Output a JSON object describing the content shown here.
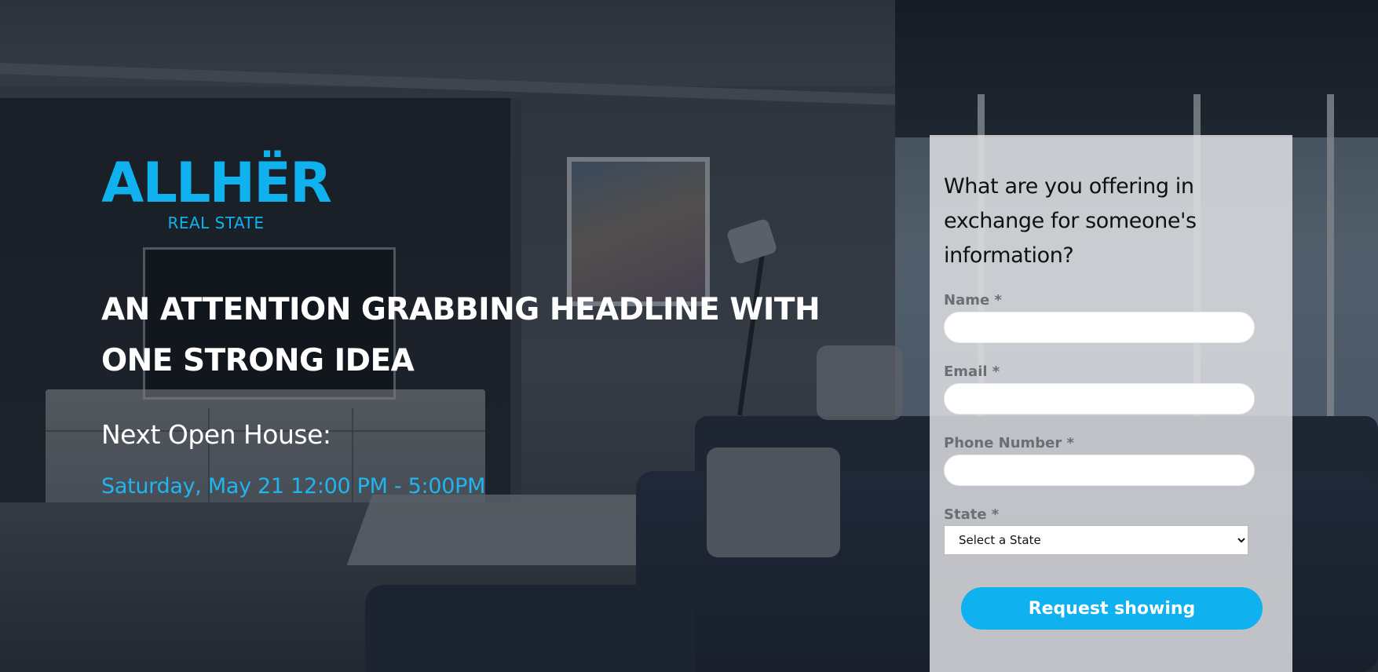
{
  "brand": {
    "name": "ALLHËR",
    "tagline": "REAL STATE",
    "accent_color": "#0fb2ee"
  },
  "hero": {
    "headline": "AN ATTENTION GRABBING HEADLINE WITH ONE STRONG IDEA",
    "open_house_label": "Next Open House:",
    "open_house_date": "Saturday, May 21 12:00 PM - 5:00PM"
  },
  "form": {
    "heading": "What are you offering in exchange for someone's information?",
    "fields": {
      "name": {
        "label": "Name *",
        "value": ""
      },
      "email": {
        "label": "Email *",
        "value": ""
      },
      "phone": {
        "label": "Phone Number *",
        "value": ""
      },
      "state": {
        "label": "State *",
        "selected": "Select a State"
      }
    },
    "submit_label": "Request showing"
  }
}
